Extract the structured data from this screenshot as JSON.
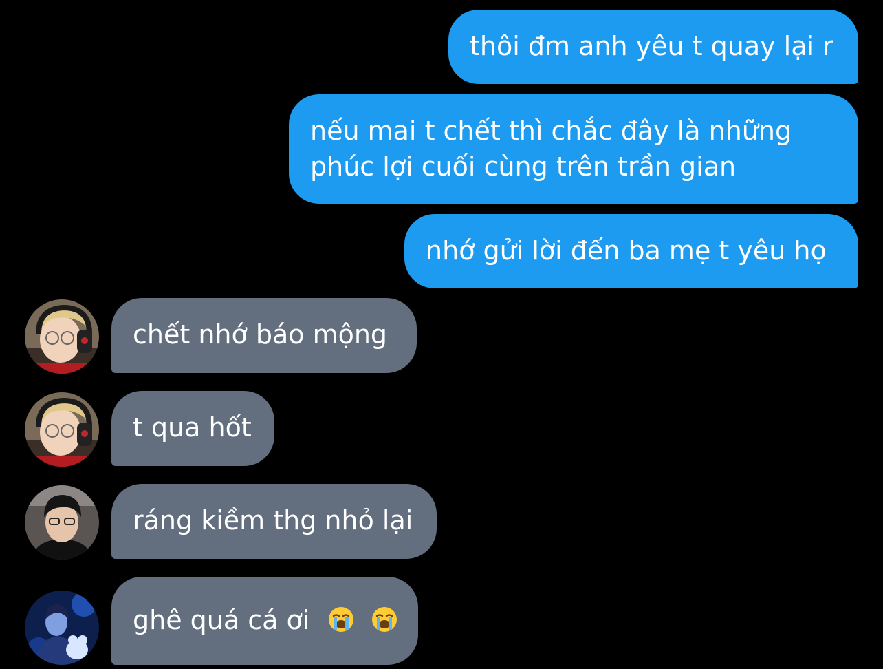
{
  "conversation": {
    "messages": [
      {
        "sender": "me",
        "text": "thôi đm anh yêu t quay lại r"
      },
      {
        "sender": "me",
        "line1": "nếu mai t chết thì chắc đây là những",
        "line2": "phúc lợi cuối cùng trên trần gian"
      },
      {
        "sender": "me",
        "text": "nhớ gửi lời đến ba mẹ t yêu họ"
      },
      {
        "sender": "friend-1",
        "text": "chết nhớ báo mộng"
      },
      {
        "sender": "friend-1",
        "text": "t qua hốt"
      },
      {
        "sender": "friend-2",
        "text": "ráng kiềm thg nhỏ lại"
      },
      {
        "sender": "friend-3",
        "text": "ghê quá cá ơi",
        "emoji": [
          "loudly-crying-face",
          "loudly-crying-face"
        ]
      }
    ]
  },
  "colors": {
    "background": "#000000",
    "sent_bubble": "#1d9bf0",
    "received_bubble": "#636f7e",
    "text": "#ffffff"
  }
}
